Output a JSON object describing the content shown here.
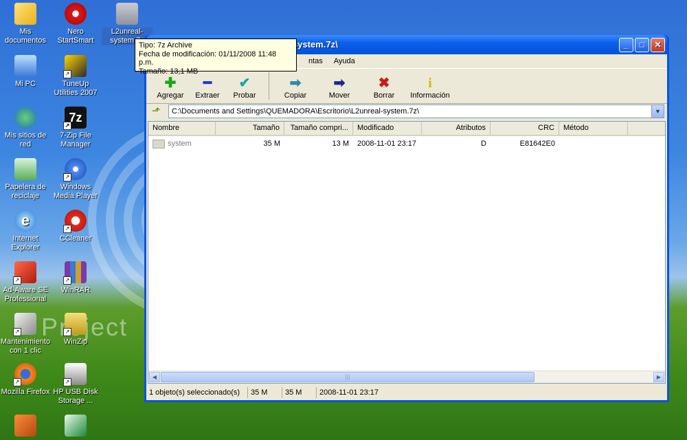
{
  "desktop": {
    "icons": [
      {
        "label": "Mis documentos",
        "icon": "my-documents-icon",
        "shortcut": false
      },
      {
        "label": "Nero StartSmart",
        "icon": "nero-icon",
        "shortcut": false
      },
      {
        "label": "L2unreal-system.7z",
        "icon": "7z-archive-icon",
        "shortcut": false
      },
      {
        "label": "Mi PC",
        "icon": "my-computer-icon",
        "shortcut": false
      },
      {
        "label": "TuneUp Utilities 2007",
        "icon": "tuneup-icon",
        "shortcut": true
      },
      {
        "label": "Mis sitios de red",
        "icon": "network-icon",
        "shortcut": false
      },
      {
        "label": "7-Zip File Manager",
        "icon": "7zip-icon",
        "shortcut": true
      },
      {
        "label": "Papelera de reciclaje",
        "icon": "recycle-bin-icon",
        "shortcut": false
      },
      {
        "label": "Windows Media Player",
        "icon": "media-player-icon",
        "shortcut": true
      },
      {
        "label": "Internet Explorer",
        "icon": "ie-icon",
        "shortcut": false
      },
      {
        "label": "CCleaner",
        "icon": "ccleaner-icon",
        "shortcut": true
      },
      {
        "label": "Ad-Aware SE Professional",
        "icon": "adaware-icon",
        "shortcut": true
      },
      {
        "label": "WinRAR",
        "icon": "winrar-icon",
        "shortcut": true
      },
      {
        "label": "Mantenimiento con 1 clic",
        "icon": "maintenance-icon",
        "shortcut": true
      },
      {
        "label": "WinZip",
        "icon": "winzip-icon",
        "shortcut": true
      },
      {
        "label": "Mozilla Firefox",
        "icon": "firefox-icon",
        "shortcut": true
      },
      {
        "label": "HP USB Disk Storage ...",
        "icon": "hp-usb-icon",
        "shortcut": true
      }
    ],
    "watermark": "Project"
  },
  "tooltip": {
    "line1": "Tipo: 7z Archive",
    "line2": "Fecha de modificación: 01/11/2008 11:48 p.m.",
    "line3": "Tamaño: 13,1 MB"
  },
  "window": {
    "title": "MADORA\\Escritorio\\L2unreal-system.7z\\",
    "buttons": {
      "minimize": "_",
      "maximize": "□",
      "close": "✕"
    },
    "menu": [
      "ntas",
      "Ayuda"
    ],
    "toolbar": [
      {
        "label": "Agregar",
        "glyph": "✚",
        "color": "#1aa51a"
      },
      {
        "label": "Extraer",
        "glyph": "━",
        "color": "#1a3ad0"
      },
      {
        "label": "Probar",
        "glyph": "✔",
        "color": "#19a8a8"
      },
      {
        "label": "Copiar",
        "glyph": "➡",
        "color": "#2a8aa8"
      },
      {
        "label": "Mover",
        "glyph": "➡",
        "color": "#1a2a8a"
      },
      {
        "label": "Borrar",
        "glyph": "✖",
        "color": "#d01818"
      },
      {
        "label": "Información",
        "glyph": "i",
        "color": "#d8b800"
      }
    ],
    "address": "C:\\Documents and Settings\\QUEMADORA\\Escritorio\\L2unreal-system.7z\\",
    "columns": [
      "Nombre",
      "Tamaño",
      "Tamaño compri...",
      "Modificado",
      "Atributos",
      "CRC",
      "Método"
    ],
    "rows": [
      {
        "name": "system",
        "size": "35 M",
        "packed": "13 M",
        "modified": "2008-11-01 23:17",
        "attributes": "D",
        "crc": "E81642E0",
        "method": ""
      }
    ],
    "status": {
      "selected": "1 objeto(s) seleccionado(s)",
      "size": "35 M",
      "packed": "35 M",
      "date": "2008-11-01 23:17"
    }
  }
}
